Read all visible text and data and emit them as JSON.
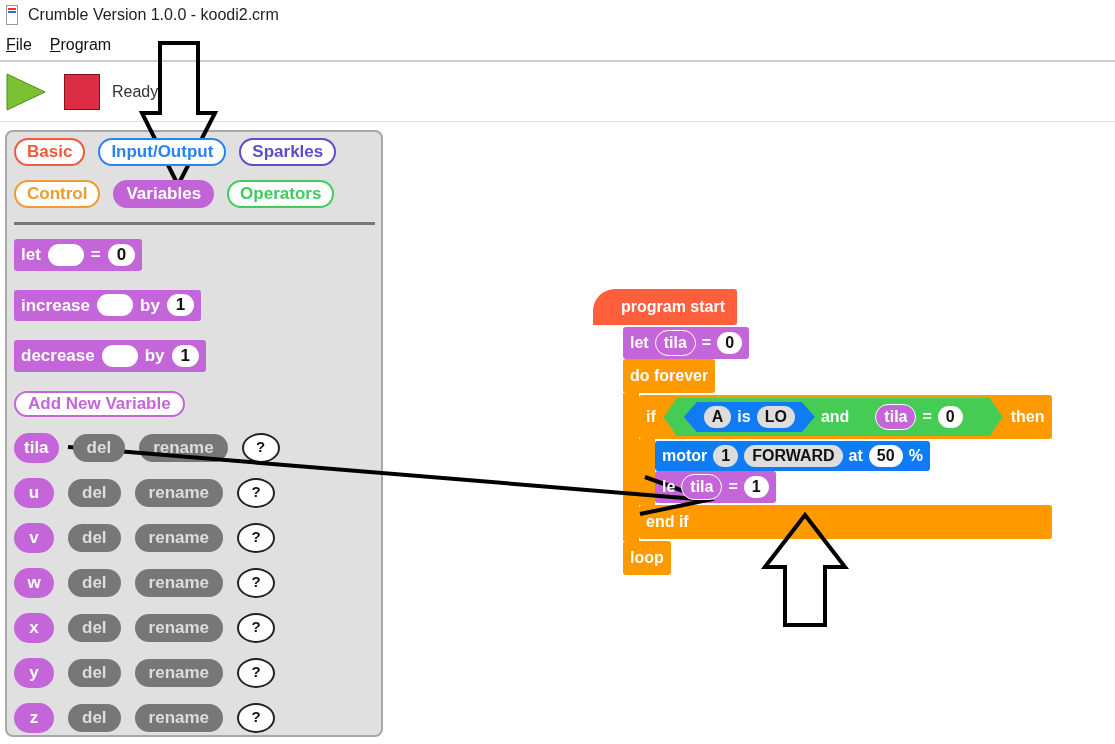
{
  "window": {
    "title": "Crumble Version 1.0.0 - koodi2.crm"
  },
  "menu": [
    {
      "label": "File"
    },
    {
      "label": "Program"
    }
  ],
  "toolbar": {
    "status": "Ready"
  },
  "palette": {
    "categories": [
      {
        "label": "Basic",
        "color": "#f05a3c",
        "selected": false
      },
      {
        "label": "Input/Output",
        "color": "#2a84f0",
        "selected": false
      },
      {
        "label": "Sparkles",
        "color": "#5a4fc8",
        "selected": false
      },
      {
        "label": "Control",
        "color": "#f39a2c",
        "selected": false
      },
      {
        "label": "Variables",
        "color": "#c264d8",
        "selected": true
      },
      {
        "label": "Operators",
        "color": "#3fcc5a",
        "selected": false
      }
    ],
    "blocks": [
      {
        "kind": "let",
        "parts": [
          {
            "kind": "text",
            "text": "let"
          },
          {
            "kind": "slot"
          },
          {
            "kind": "text",
            "text": "="
          },
          {
            "kind": "value",
            "text": "0"
          }
        ]
      },
      {
        "kind": "let",
        "parts": [
          {
            "kind": "text",
            "text": "increase"
          },
          {
            "kind": "slot"
          },
          {
            "kind": "text",
            "text": "by"
          },
          {
            "kind": "value",
            "text": "1"
          }
        ]
      },
      {
        "kind": "let",
        "parts": [
          {
            "kind": "text",
            "text": "decrease"
          },
          {
            "kind": "slot"
          },
          {
            "kind": "text",
            "text": "by"
          },
          {
            "kind": "value",
            "text": "1"
          }
        ]
      }
    ],
    "add_variable": "Add New Variable",
    "variables": [
      {
        "name": "tila",
        "del": "del",
        "rename": "rename",
        "help": "?"
      },
      {
        "name": "u",
        "del": "del",
        "rename": "rename",
        "help": "?"
      },
      {
        "name": "v",
        "del": "del",
        "rename": "rename",
        "help": "?"
      },
      {
        "name": "w",
        "del": "del",
        "rename": "rename",
        "help": "?"
      },
      {
        "name": "x",
        "del": "del",
        "rename": "rename",
        "help": "?"
      },
      {
        "name": "y",
        "del": "del",
        "rename": "rename",
        "help": "?"
      },
      {
        "name": "z",
        "del": "del",
        "rename": "rename",
        "help": "?"
      }
    ]
  },
  "script": {
    "hat": "program start",
    "body": [
      {
        "kind": "let",
        "parts": [
          {
            "kind": "text",
            "text": "let"
          },
          {
            "kind": "var",
            "text": "tila"
          },
          {
            "kind": "text",
            "text": "="
          },
          {
            "kind": "value",
            "text": "0"
          }
        ]
      },
      {
        "kind": "forever",
        "label": "do forever",
        "end": "loop",
        "children": [
          {
            "kind": "if",
            "parts": [
              {
                "kind": "text",
                "text": "if"
              },
              {
                "kind": "hex",
                "color": "#44cc55",
                "parts": [
                  {
                    "kind": "hex",
                    "color": "#0f7cf5",
                    "parts": [
                      {
                        "kind": "choice",
                        "text": "A"
                      },
                      {
                        "kind": "text",
                        "text": "is"
                      },
                      {
                        "kind": "choice",
                        "text": "LO"
                      }
                    ]
                  },
                  {
                    "kind": "text",
                    "text": "and"
                  },
                  {
                    "kind": "hex",
                    "color": "#44cc55",
                    "parts": [
                      {
                        "kind": "var",
                        "text": "tila"
                      },
                      {
                        "kind": "text",
                        "text": "="
                      },
                      {
                        "kind": "value",
                        "text": "0"
                      }
                    ]
                  }
                ]
              },
              {
                "kind": "text",
                "text": "then"
              }
            ],
            "end": "end if",
            "children": [
              {
                "kind": "motor",
                "parts": [
                  {
                    "kind": "text",
                    "text": "motor"
                  },
                  {
                    "kind": "choice",
                    "text": "1"
                  },
                  {
                    "kind": "choice",
                    "text": "FORWARD"
                  },
                  {
                    "kind": "text",
                    "text": "at"
                  },
                  {
                    "kind": "value",
                    "text": "50"
                  },
                  {
                    "kind": "text",
                    "text": "%"
                  }
                ]
              },
              {
                "kind": "let",
                "parts": [
                  {
                    "kind": "text",
                    "text": "le"
                  },
                  {
                    "kind": "var",
                    "text": "tila"
                  },
                  {
                    "kind": "text",
                    "text": "="
                  },
                  {
                    "kind": "value",
                    "text": "1"
                  }
                ]
              }
            ]
          }
        ]
      }
    ]
  }
}
